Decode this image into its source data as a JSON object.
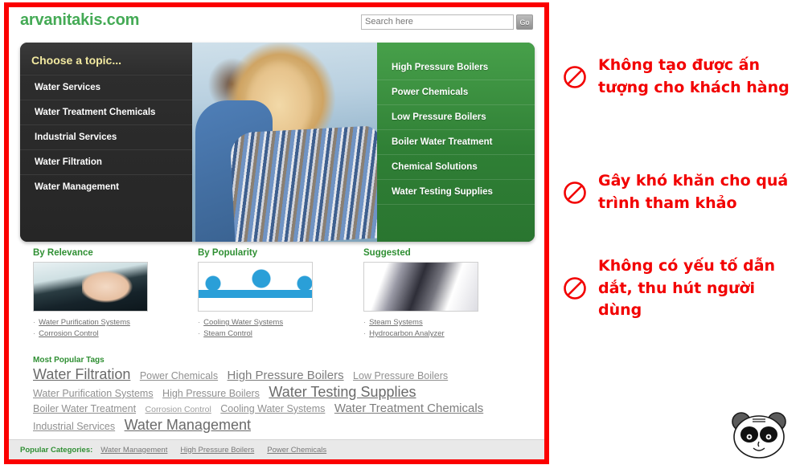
{
  "screenshot": {
    "header": {
      "logo": "arvanitakis.com",
      "search_placeholder": "Search here",
      "search_value": "",
      "go_label": "Go"
    },
    "hero": {
      "left_title": "Choose a topic...",
      "left_items": [
        "Water Services",
        "Water Treatment Chemicals",
        "Industrial Services",
        "Water Filtration",
        "Water Management"
      ],
      "right_items": [
        "High Pressure Boilers",
        "Power Chemicals",
        "Low Pressure Boilers",
        "Boiler Water Treatment",
        "Chemical Solutions",
        "Water Testing Supplies"
      ]
    },
    "columns": [
      {
        "title": "By Relevance",
        "thumb": "laptop-typing-photo",
        "links": [
          "Water Purification Systems",
          "Corrosion Control"
        ]
      },
      {
        "title": "By Popularity",
        "thumb": "blue-people-icon",
        "links": [
          "Cooling Water Systems",
          "Steam Control"
        ]
      },
      {
        "title": "Suggested",
        "thumb": "abstract-grayscale-photo",
        "links": [
          "Steam Systems",
          "Hydrocarbon Analyzer"
        ]
      }
    ],
    "tags": {
      "title": "Most Popular Tags",
      "items": [
        {
          "label": "Water Filtration",
          "size": 4
        },
        {
          "label": "Power Chemicals",
          "size": 2
        },
        {
          "label": "High Pressure Boilers",
          "size": 3
        },
        {
          "label": "Low Pressure Boilers",
          "size": 2
        },
        {
          "label": "Water Purification Systems",
          "size": 2
        },
        {
          "label": "High Pressure Boilers",
          "size": 2
        },
        {
          "label": "Water Testing Supplies",
          "size": 4
        },
        {
          "label": "Boiler Water Treatment",
          "size": 2
        },
        {
          "label": "Corrosion Control",
          "size": 1
        },
        {
          "label": "Cooling Water Systems",
          "size": 2
        },
        {
          "label": "Water Treatment Chemicals",
          "size": 3
        },
        {
          "label": "Industrial Services",
          "size": 2
        },
        {
          "label": "Water Management",
          "size": 4
        }
      ]
    },
    "footer": {
      "label": "Popular Categories:",
      "links": [
        "Water Management",
        "High Pressure Boilers",
        "Power Chemicals"
      ]
    }
  },
  "annotations": [
    {
      "icon": "prohibition-icon",
      "text": "Không tạo được ấn tượng cho khách hàng"
    },
    {
      "icon": "prohibition-icon",
      "text": "Gây khó khăn cho quá trình tham khảo"
    },
    {
      "icon": "prohibition-icon",
      "text": "Không có yếu tố dẫn dắt, thu hút người dùng"
    }
  ],
  "branding": {
    "logo": "panda-face-logo"
  },
  "colors": {
    "frame_red": "#fb0000",
    "annotation_red": "#f20000",
    "brand_green": "#44aa55",
    "heading_green": "#2f8f33",
    "menu_dark": "#2d2d2d",
    "menu_green": "#2f7f35"
  }
}
